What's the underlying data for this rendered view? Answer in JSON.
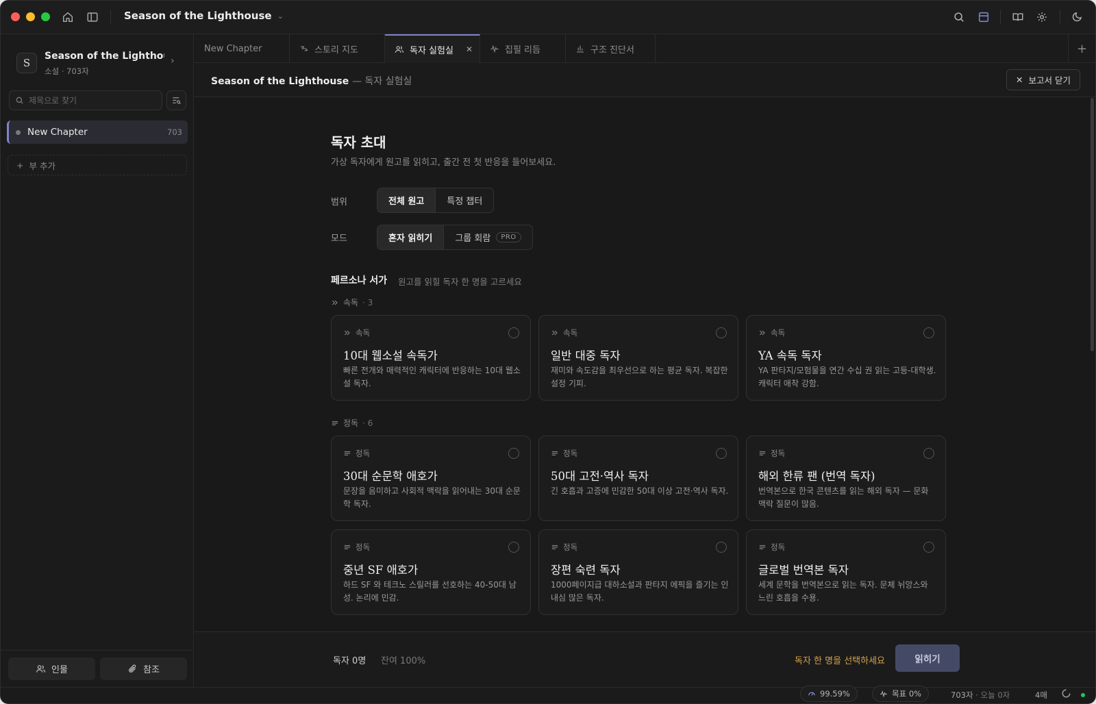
{
  "window": {
    "title": "Season of the Lighthouse"
  },
  "toolbar_icons": [
    "home-icon",
    "sidebar-toggle-icon",
    "search-icon",
    "layout-icon",
    "book-icon",
    "gear-icon",
    "theme-icon"
  ],
  "project": {
    "initial": "S",
    "name": "Season of the Lighthouse",
    "meta": "소설 · 703자"
  },
  "sidebar": {
    "search_placeholder": "제목으로 찾기",
    "chapters": [
      {
        "label": "New Chapter",
        "count": "703"
      }
    ],
    "add_part_label": "부 추가",
    "footer": {
      "characters_label": "인물",
      "references_label": "참조"
    }
  },
  "tabs": [
    {
      "label": "New Chapter",
      "icon": "",
      "active": false
    },
    {
      "label": "스토리 지도",
      "icon": "flow-icon",
      "active": false
    },
    {
      "label": "독자 실험실",
      "icon": "users-icon",
      "active": true
    },
    {
      "label": "집필 리듬",
      "icon": "pulse-icon",
      "active": false
    },
    {
      "label": "구조 진단서",
      "icon": "bar-chart-icon",
      "active": false
    }
  ],
  "header": {
    "project": "Season of the Lighthouse",
    "section": "— 독자 실험실",
    "close_label": "보고서 닫기"
  },
  "invite": {
    "title": "독자 초대",
    "description": "가상 독자에게 원고를 읽히고, 출간 전 첫 반응을 들어보세요.",
    "scope_label": "범위",
    "scope_options": [
      "전체 원고",
      "특정 챕터"
    ],
    "mode_label": "모드",
    "mode_options": [
      "혼자 읽히기",
      "그룹 회람"
    ],
    "pro_badge": "PRO"
  },
  "persona_shelf": {
    "title": "페르소나 서가",
    "hint": "원고를 읽힐 독자 한 명을 고르세요",
    "groups": [
      {
        "label": "속독",
        "count": "· 3",
        "cards": [
          {
            "tag": "속독",
            "name": "10대 웹소설 속독가",
            "desc": "빠른 전개와 매력적인 캐릭터에 반응하는 10대 웹소설 독자."
          },
          {
            "tag": "속독",
            "name": "일반 대중 독자",
            "desc": "재미와 속도감을 최우선으로 하는 평균 독자. 복잡한 설정 기피."
          },
          {
            "tag": "속독",
            "name": "YA 속독 독자",
            "desc": "YA 판타지/모험물을 연간 수십 권 읽는 고등-대학생. 캐릭터 애착 강함."
          }
        ]
      },
      {
        "label": "정독",
        "count": "· 6",
        "cards": [
          {
            "tag": "정독",
            "name": "30대 순문학 애호가",
            "desc": "문장을 음미하고 사회적 맥락을 읽어내는 30대 순문학 독자."
          },
          {
            "tag": "정독",
            "name": "50대 고전·역사 독자",
            "desc": "긴 호흡과 고증에 민감한 50대 이상 고전·역사 독자."
          },
          {
            "tag": "정독",
            "name": "해외 한류 팬 (번역 독자)",
            "desc": "번역본으로 한국 콘텐츠를 읽는 해외 독자 — 문화 맥락 질문이 많음."
          },
          {
            "tag": "정독",
            "name": "중년 SF 애호가",
            "desc": "하드 SF 와 테크노 스릴러를 선호하는 40-50대 남성. 논리에 민감."
          },
          {
            "tag": "정독",
            "name": "장편 숙련 독자",
            "desc": "1000페이지급 대하소설과 판타지 에픽을 즐기는 인내심 많은 독자."
          },
          {
            "tag": "정독",
            "name": "글로벌 번역본 독자",
            "desc": "세계 문학을 번역본으로 읽는 독자. 문체 뉘앙스와 느린 호흡을 수용."
          }
        ]
      }
    ]
  },
  "action": {
    "readers": "독자 0명",
    "remaining": "잔여 100%",
    "warning": "독자 한 명을 선택하세요",
    "read_label": "읽히기",
    "accent": "#7d86c9",
    "warning_color": "#d4a24a"
  },
  "status": {
    "accuracy": "99.59%",
    "goal": "목표 0%",
    "chars": "703자",
    "today": "오늘 0자",
    "pages": "4매"
  }
}
